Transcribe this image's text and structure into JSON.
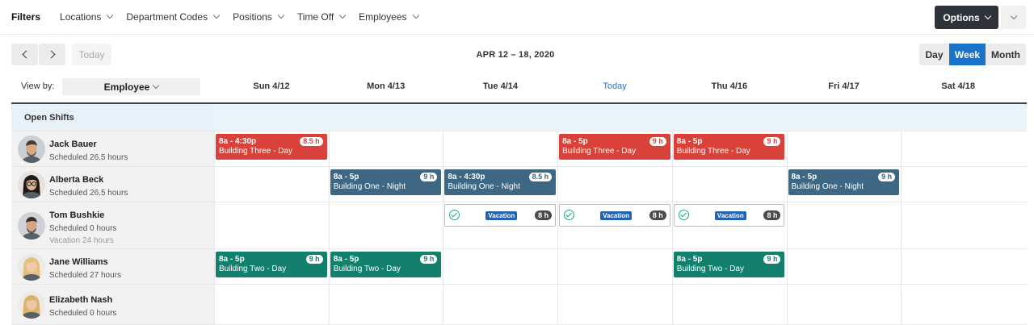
{
  "filters": {
    "title": "Filters",
    "items": [
      "Locations",
      "Department Codes",
      "Positions",
      "Time Off",
      "Employees"
    ],
    "options_label": "Options"
  },
  "nav": {
    "today_label": "Today",
    "range": "APR 12 – 18, 2020",
    "views": [
      "Day",
      "Week",
      "Month"
    ],
    "active_view": "Week"
  },
  "header": {
    "view_by_label": "View by:",
    "view_by_value": "Employee",
    "days": [
      "Sun 4/12",
      "Mon 4/13",
      "Tue 4/14",
      "Today",
      "Thu 4/16",
      "Fri 4/17",
      "Sat 4/18"
    ]
  },
  "open_shifts_label": "Open Shifts",
  "employees": [
    {
      "name": "Jack Bauer",
      "scheduled": "Scheduled 26.5 hours"
    },
    {
      "name": "Alberta Beck",
      "scheduled": "Scheduled 26.5 hours"
    },
    {
      "name": "Tom Bushkie",
      "scheduled": "Scheduled 0 hours",
      "vacation": "Vacation 24 hours"
    },
    {
      "name": "Jane Williams",
      "scheduled": "Scheduled 27 hours"
    },
    {
      "name": "Elizabeth Nash",
      "scheduled": "Scheduled 0 hours"
    }
  ],
  "shifts": [
    {
      "employee": 0,
      "day": 0,
      "time": "8a - 4:30p",
      "location": "Building Three - Day",
      "hours": "8.5 h",
      "color": "#d9423a"
    },
    {
      "employee": 0,
      "day": 3,
      "time": "8a - 5p",
      "location": "Building Three - Day",
      "hours": "9 h",
      "color": "#d9423a"
    },
    {
      "employee": 0,
      "day": 4,
      "time": "8a - 5p",
      "location": "Building Three - Day",
      "hours": "9 h",
      "color": "#d9423a"
    },
    {
      "employee": 1,
      "day": 1,
      "time": "8a - 5p",
      "location": "Building One - Night",
      "hours": "9 h",
      "color": "#3e6783"
    },
    {
      "employee": 1,
      "day": 2,
      "time": "8a - 4:30p",
      "location": "Building One - Night",
      "hours": "8.5 h",
      "color": "#3e6783"
    },
    {
      "employee": 1,
      "day": 5,
      "time": "8a - 5p",
      "location": "Building One - Night",
      "hours": "9 h",
      "color": "#3e6783"
    },
    {
      "employee": 3,
      "day": 0,
      "time": "8a - 5p",
      "location": "Building Two - Day",
      "hours": "9 h",
      "color": "#13806e"
    },
    {
      "employee": 3,
      "day": 1,
      "time": "8a - 5p",
      "location": "Building Two - Day",
      "hours": "9 h",
      "color": "#13806e"
    },
    {
      "employee": 3,
      "day": 4,
      "time": "8a - 5p",
      "location": "Building Two - Day",
      "hours": "9 h",
      "color": "#13806e"
    }
  ],
  "vacations": [
    {
      "employee": 2,
      "day": 2,
      "label": "Vacation",
      "hours": "8 h"
    },
    {
      "employee": 2,
      "day": 3,
      "label": "Vacation",
      "hours": "8 h"
    },
    {
      "employee": 2,
      "day": 4,
      "label": "Vacation",
      "hours": "8 h"
    }
  ]
}
